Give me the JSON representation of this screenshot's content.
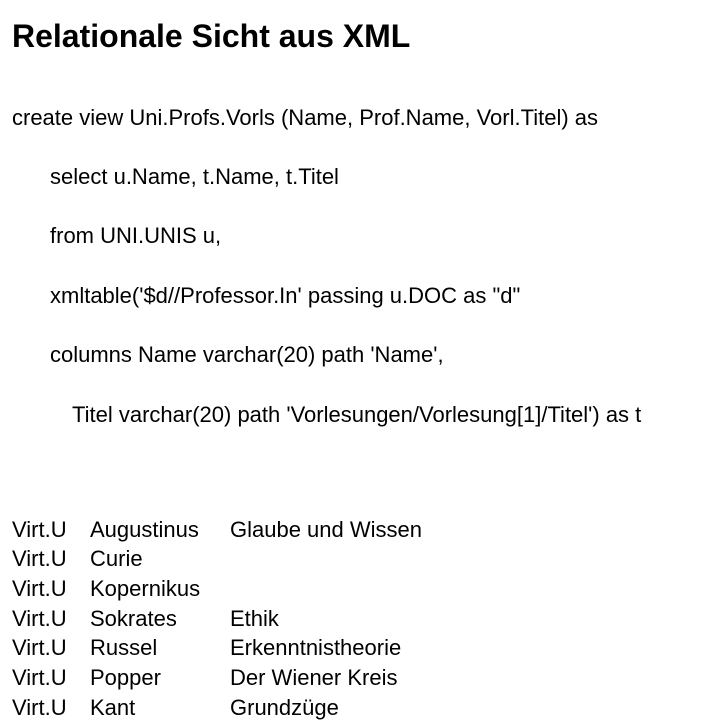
{
  "title": "Relationale Sicht aus XML",
  "code": {
    "l0": "create view Uni.Profs.Vorls (Name, Prof.Name, Vorl.Titel) as",
    "l1": "select u.Name, t.Name, t.Titel",
    "l2": "from UNI.UNIS u,",
    "l3": "xmltable('$d//Professor.In' passing u.DOC as \"d\"",
    "l4": "columns Name varchar(20) path 'Name',",
    "l5": "Titel varchar(20) path 'Vorlesungen/Vorlesung[1]/Titel') as t"
  },
  "rows": [
    {
      "c1": "Virt.U",
      "c2": "Augustinus",
      "c3": "Glaube und Wissen"
    },
    {
      "c1": "Virt.U",
      "c2": "Curie",
      "c3": ""
    },
    {
      "c1": "Virt.U",
      "c2": "Kopernikus",
      "c3": ""
    },
    {
      "c1": "Virt.U",
      "c2": "Sokrates",
      "c3": "Ethik"
    },
    {
      "c1": "Virt.U",
      "c2": "Russel",
      "c3": "Erkenntnistheorie"
    },
    {
      "c1": "Virt.U",
      "c2": "Popper",
      "c3": "Der Wiener Kreis"
    },
    {
      "c1": "Virt.U",
      "c2": "Kant",
      "c3": "Grundzüge"
    }
  ]
}
